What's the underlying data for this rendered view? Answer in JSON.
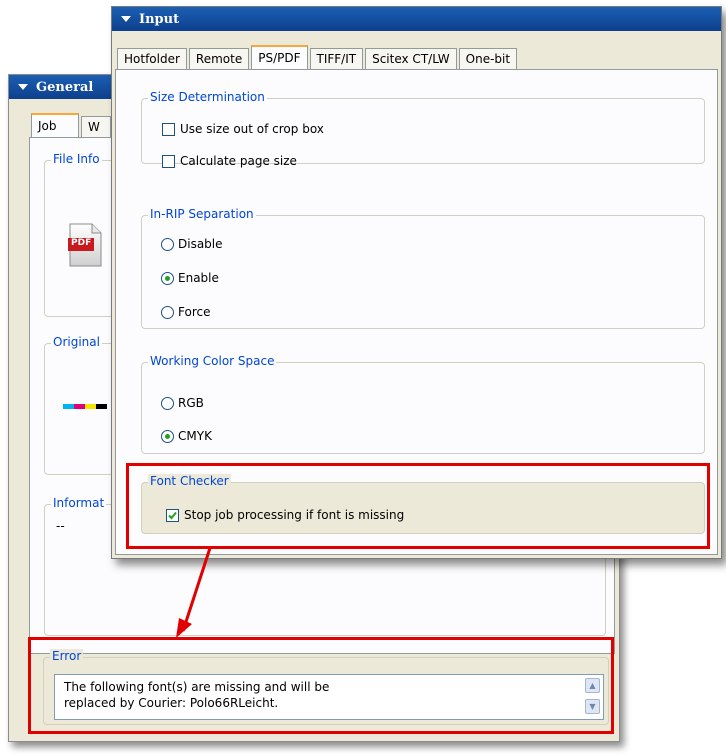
{
  "general_window": {
    "title": "General",
    "tabs": [
      {
        "label": "Job"
      },
      {
        "label": "W"
      }
    ],
    "groups": {
      "file_info": "File Info",
      "original": "Original",
      "information": "Informat",
      "information_value": "--",
      "error": "Error"
    },
    "pdf_icon_label": "PDF",
    "error_message": "The following font(s) are missing and will be\nreplaced by Courier: Polo66RLeicht.",
    "colors": {
      "cyan": "#00b4f0",
      "magenta": "#e0007a",
      "yellow": "#f5e600",
      "black": "#000000"
    }
  },
  "input_window": {
    "title": "Input",
    "tabs": [
      {
        "label": "Hotfolder",
        "active": false
      },
      {
        "label": "Remote",
        "active": false
      },
      {
        "label": "PS/PDF",
        "active": true
      },
      {
        "label": "TIFF/IT",
        "active": false
      },
      {
        "label": "Scitex CT/LW",
        "active": false
      },
      {
        "label": "One-bit",
        "active": false
      }
    ],
    "size_determination": {
      "legend": "Size Determination",
      "options": [
        {
          "label": "Use size out of crop box",
          "checked": false
        },
        {
          "label": "Calculate page size",
          "checked": false
        }
      ]
    },
    "in_rip_separation": {
      "legend": "In-RIP Separation",
      "options": [
        {
          "label": "Disable",
          "selected": false
        },
        {
          "label": "Enable",
          "selected": true
        },
        {
          "label": "Force",
          "selected": false
        }
      ]
    },
    "working_color_space": {
      "legend": "Working Color Space",
      "options": [
        {
          "label": "RGB",
          "selected": false
        },
        {
          "label": "CMYK",
          "selected": true
        }
      ]
    },
    "font_checker": {
      "legend": "Font Checker",
      "option": {
        "label": "Stop job processing if font is missing",
        "checked": true
      }
    }
  },
  "colors": {
    "highlight": "#e00000",
    "legend_text": "#0046d5",
    "titlebar": "#0d3f8c",
    "active_tab": "#f6a83c"
  }
}
